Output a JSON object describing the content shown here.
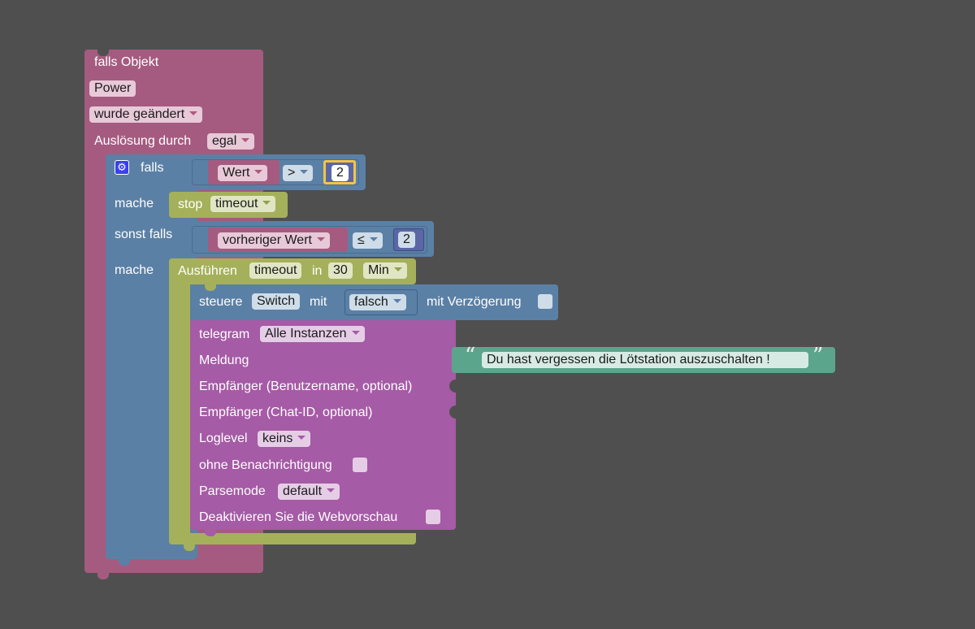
{
  "colors": {
    "canvas": "#4f4f4f",
    "trigger": "#a55b80",
    "logic": "#5b80a5",
    "timer": "#a5b05b",
    "telegram": "#a55ba5",
    "text": "#5ba58c",
    "math": "#5b67a5"
  },
  "trigger": {
    "title": "falls Objekt",
    "object": "Power",
    "condition": "wurde geändert",
    "cause_label": "Auslösung durch",
    "cause_value": "egal"
  },
  "if_block": {
    "gear_icon": "gear-icon",
    "if_label": "falls",
    "compare1": {
      "left": "Wert",
      "op": ">",
      "right": "2"
    },
    "do_label": "mache",
    "stop": {
      "label": "stop",
      "value": "timeout"
    },
    "elseif_label": "sonst falls",
    "compare2": {
      "left": "vorheriger Wert",
      "op": "≤",
      "right": "2"
    },
    "do2_label": "mache"
  },
  "timeout": {
    "label": "Ausführen",
    "name": "timeout",
    "in_label": "in",
    "amount": "30",
    "unit": "Min"
  },
  "control": {
    "label": "steuere",
    "target": "Switch",
    "with_label": "mit",
    "value": "falsch",
    "delay_label": "mit Verzögerung"
  },
  "telegram": {
    "label": "telegram",
    "instance": "Alle Instanzen",
    "message_label": "Meldung",
    "message_text": "Du hast vergessen die Lötstation auszuschalten !",
    "quote_open": "“",
    "quote_close": "”",
    "recipient_user_label": "Empfänger (Benutzername, optional)",
    "recipient_chat_label": "Empfänger (Chat-ID, optional)",
    "loglevel_label": "Loglevel",
    "loglevel_value": "keins",
    "silent_label": "ohne Benachrichtigung",
    "parsemode_label": "Parsemode",
    "parsemode_value": "default",
    "preview_label": "Deaktivieren Sie die Webvorschau"
  }
}
